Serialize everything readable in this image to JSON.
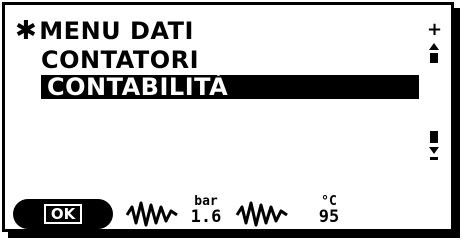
{
  "menu": {
    "star": "✱",
    "title": "MENU DATI",
    "items": [
      {
        "label": "CONTATORI"
      },
      {
        "label": "CONTABILITÀ"
      }
    ]
  },
  "scrollbar": {
    "plus": "+"
  },
  "footer": {
    "ok_label": "OK",
    "pressure_unit": "bar",
    "pressure_value": "1.6",
    "temperature_unit": "°C",
    "temperature_value": "95"
  }
}
